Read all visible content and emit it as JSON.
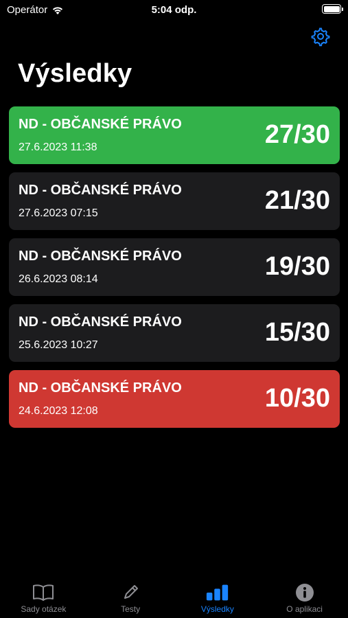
{
  "status_bar": {
    "carrier": "Operátor",
    "time": "5:04 odp."
  },
  "header": {
    "title": "Výsledky"
  },
  "results": [
    {
      "name": "ND - OBČANSKÉ PRÁVO",
      "date": "27.6.2023 11:38",
      "score": "27/30",
      "status": "good"
    },
    {
      "name": "ND - OBČANSKÉ PRÁVO",
      "date": "27.6.2023 07:15",
      "score": "21/30",
      "status": "neutral"
    },
    {
      "name": "ND - OBČANSKÉ PRÁVO",
      "date": "26.6.2023 08:14",
      "score": "19/30",
      "status": "neutral"
    },
    {
      "name": "ND - OBČANSKÉ PRÁVO",
      "date": "25.6.2023 10:27",
      "score": "15/30",
      "status": "neutral"
    },
    {
      "name": "ND - OBČANSKÉ PRÁVO",
      "date": "24.6.2023 12:08",
      "score": "10/30",
      "status": "bad"
    }
  ],
  "tabs": [
    {
      "label": "Sady otázek",
      "icon": "book-icon",
      "active": false
    },
    {
      "label": "Testy",
      "icon": "pencil-icon",
      "active": false
    },
    {
      "label": "Výsledky",
      "icon": "chart-bar-icon",
      "active": true
    },
    {
      "label": "O aplikaci",
      "icon": "info-icon",
      "active": false
    }
  ],
  "colors": {
    "accent": "#1a84ff",
    "good": "#33b24a",
    "bad": "#cf3832",
    "card": "#1c1c1e",
    "inactive": "#8e8e93"
  }
}
